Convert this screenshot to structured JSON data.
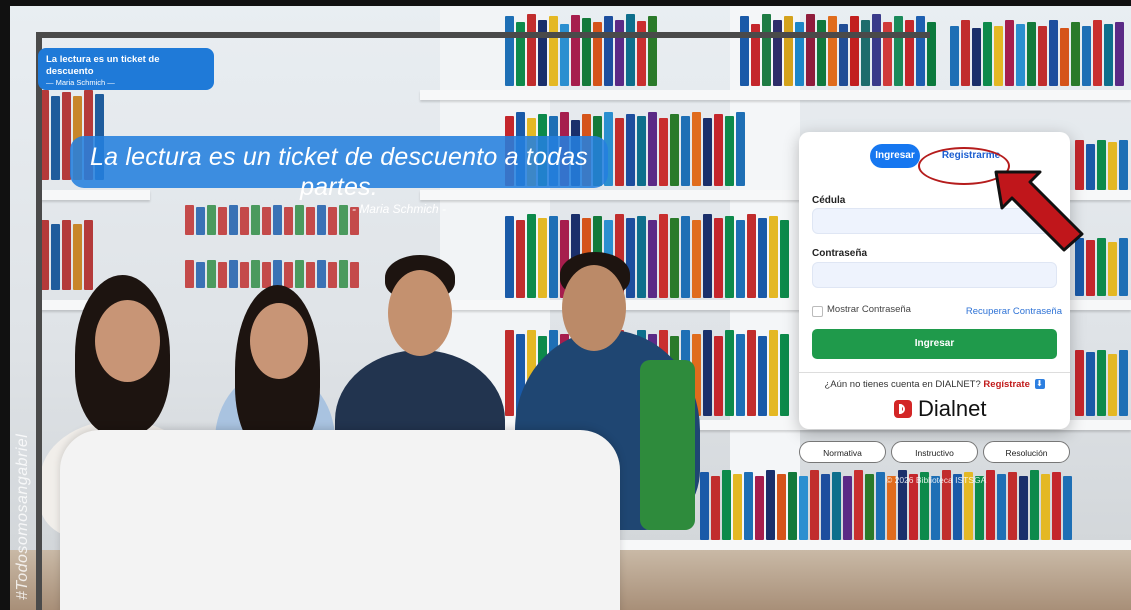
{
  "quote_card": {
    "quote": "La lectura es un ticket de descuento",
    "author": "— Maria Schmich —"
  },
  "banner": {
    "quote": "La lectura es un ticket de descuento a todas partes.",
    "author": "- Maria Schmich -"
  },
  "hashtag": "#Todosomosangabriel",
  "login": {
    "tab_login": "Ingresar",
    "tab_register": "Registrarme",
    "id_label": "Cédula",
    "id_value": "",
    "password_label": "Contraseña",
    "password_value": "",
    "show_password_label": "Mostrar Contraseña",
    "recover_link": "Recuperar Contraseña",
    "login_button": "Ingresar",
    "dialnet_question": "¿Aún no tienes cuenta en DIALNET?",
    "dialnet_register": "Regístrate",
    "dialnet_brand": "Dialnet"
  },
  "pills": [
    "Normativa",
    "Instructivo",
    "Resolución"
  ],
  "copyright": "© 2026 Biblioteca ISTSGA",
  "colors": {
    "primary": "#1677f0",
    "success": "#1f9a4b",
    "highlight": "#b51c1c"
  }
}
